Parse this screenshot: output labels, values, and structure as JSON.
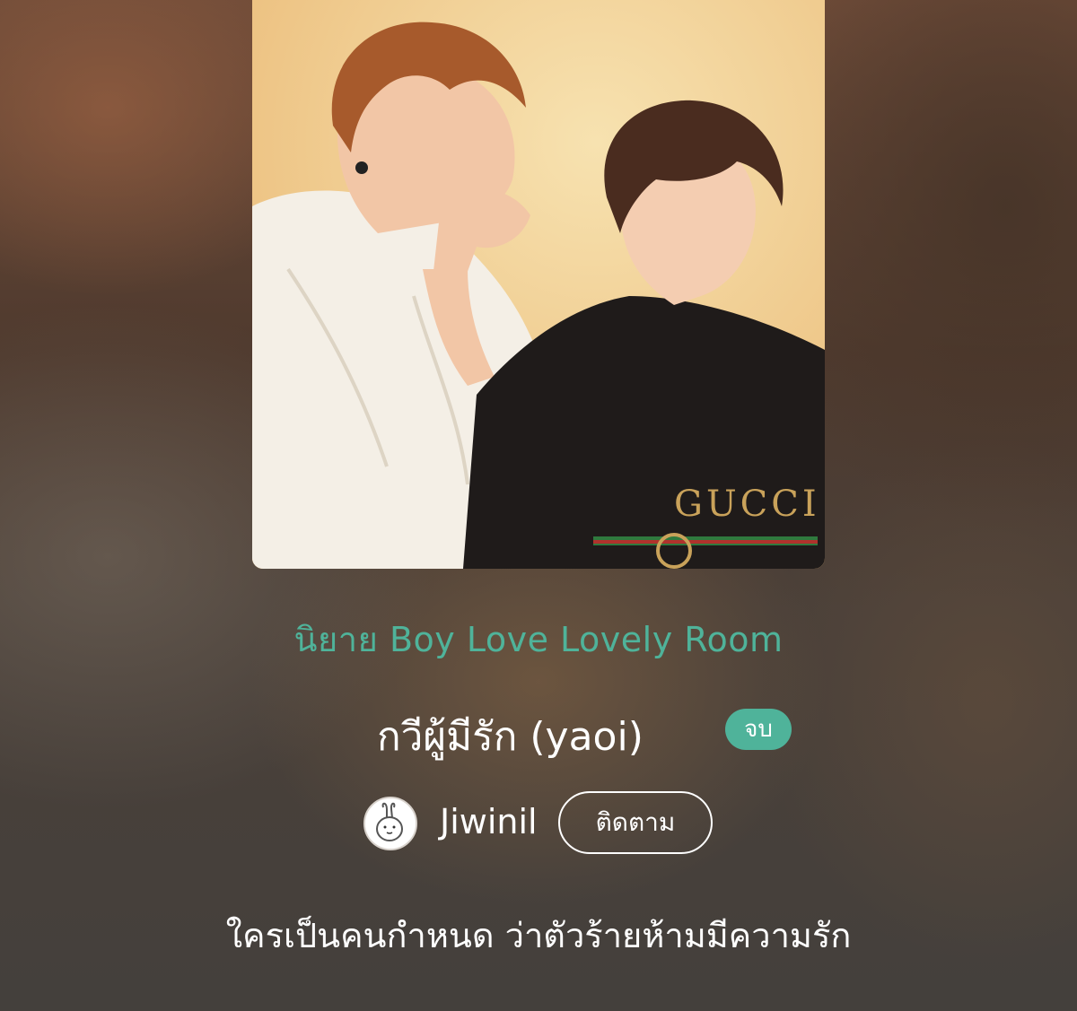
{
  "cover": {
    "icon": "cover-illustration",
    "shirt_text": "GUCCI"
  },
  "category_label": "นิยาย Boy Love Lovely Room",
  "title": "กวีผู้มีรัก (yaoi)",
  "status_badge": "จบ",
  "author": {
    "name": "Jiwinil",
    "avatar_icon": "bunny-avatar",
    "follow_label": "ติดตาม"
  },
  "tagline": "ใครเป็นคนกำหนด ว่าตัวร้ายห้ามมีความรัก",
  "colors": {
    "accent": "#4fb39a",
    "text": "#ffffff"
  }
}
